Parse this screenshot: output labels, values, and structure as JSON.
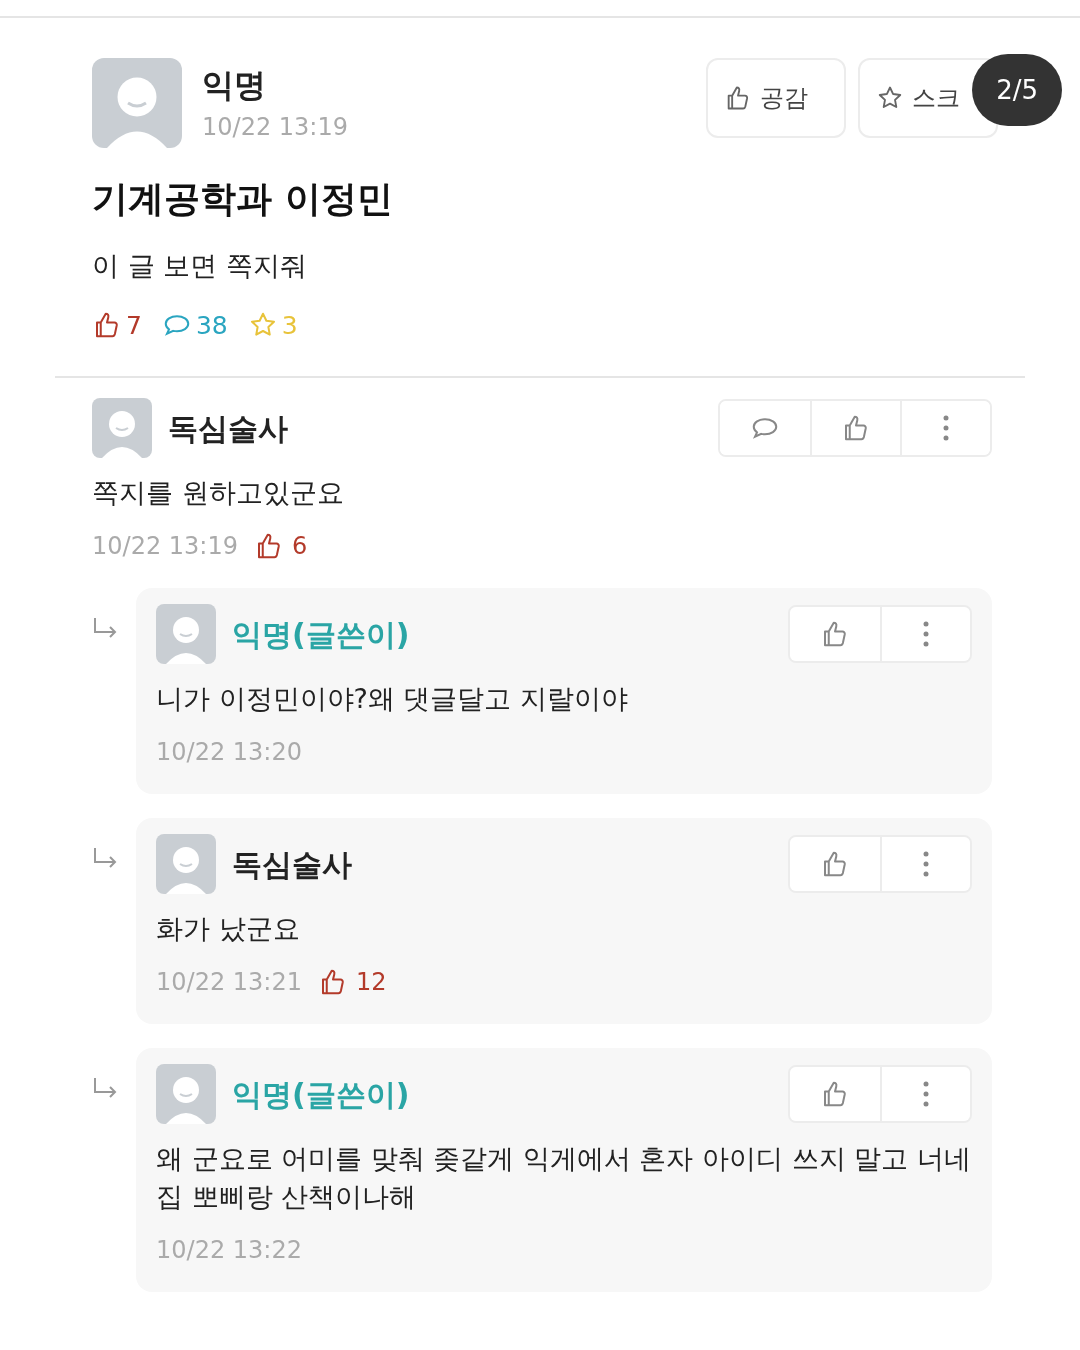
{
  "post": {
    "author": "익명",
    "time": "10/22 13:19",
    "title": "기계공학과 이정민",
    "body": "이 글 보면 쪽지줘",
    "buttons": [
      {
        "kind": "like",
        "label": "공감"
      },
      {
        "kind": "scrap",
        "label": "스크"
      }
    ],
    "page_indicator": "2/5",
    "stats": {
      "likes": "7",
      "comments": "38",
      "scraps": "3"
    }
  },
  "comments": [
    {
      "author": "독심술사",
      "is_writer": false,
      "text": "쪽지를 원하고있군요",
      "time": "10/22 13:19",
      "likes": "6",
      "actions": [
        {
          "kind": "comment"
        },
        {
          "kind": "like"
        },
        {
          "kind": "more"
        }
      ],
      "replies": [
        {
          "author": "익명(글쓴이)",
          "is_writer": true,
          "text": "니가 이정민이야?왜 댓글달고 지랄이야",
          "time": "10/22 13:20",
          "actions": [
            {
              "kind": "like"
            },
            {
              "kind": "more"
            }
          ]
        },
        {
          "author": "독심술사",
          "is_writer": false,
          "text": "화가 났군요",
          "time": "10/22 13:21",
          "likes": "12",
          "actions": [
            {
              "kind": "like"
            },
            {
              "kind": "more"
            }
          ]
        },
        {
          "author": "익명(글쓴이)",
          "is_writer": true,
          "text": "왜 군요로 어미를 맞춰 좆같게 익게에서 혼자 아이디 쓰지 말고 너네집 뽀삐랑 산책이나해",
          "time": "10/22 13:22",
          "actions": [
            {
              "kind": "like"
            },
            {
              "kind": "more"
            }
          ]
        }
      ]
    }
  ]
}
